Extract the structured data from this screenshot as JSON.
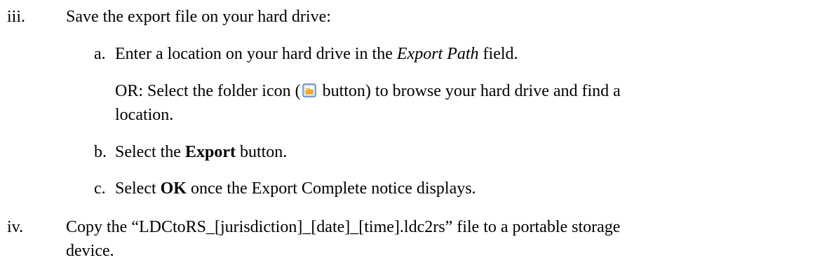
{
  "steps": [
    {
      "marker": "iii.",
      "text": "Save the export file on your hard drive:",
      "substeps": [
        {
          "marker": "a.",
          "pre": "Enter a location on your hard drive in the ",
          "em": "Export Path",
          "post": " field."
        },
        {
          "or_pre": "OR: Select the folder icon (",
          "or_icon": "folder-icon",
          "or_post": " button) to browse your hard drive and find a",
          "or_cont": "location."
        },
        {
          "marker": "b.",
          "pre": "Select the ",
          "bold": "Export",
          "post": " button."
        },
        {
          "marker": "c.",
          "pre": "Select ",
          "bold": "OK",
          "post": " once the Export Complete notice displays."
        }
      ]
    },
    {
      "marker": "iv.",
      "text": "Copy the “LDCtoRS_[jurisdiction]_[date]_[time].ldc2rs” file to a portable storage",
      "text_cont": "device."
    }
  ],
  "icon_colors": {
    "folder_border": "#4a7ebb",
    "folder_fill": "#ffffff",
    "folder_tab": "#f2b01e"
  }
}
